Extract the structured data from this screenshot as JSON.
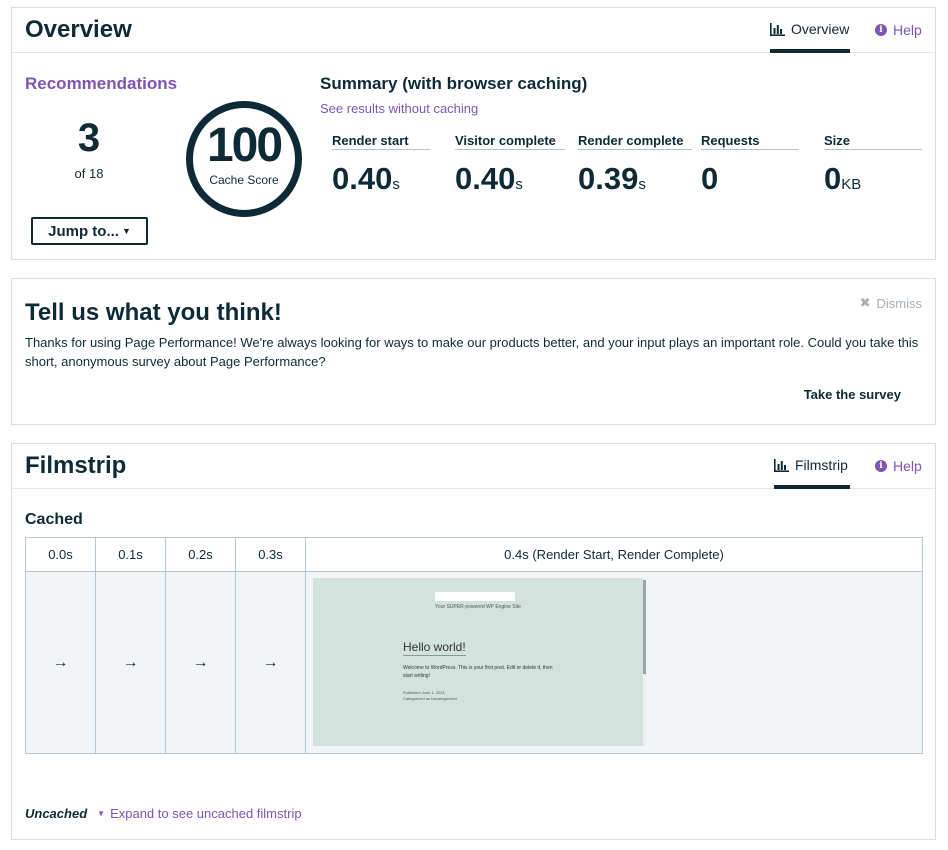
{
  "overview": {
    "title": "Overview",
    "tab_label": "Overview",
    "help_label": "Help",
    "recommendations": {
      "title": "Recommendations",
      "count": "3",
      "of_text": "of 18",
      "jump_label": "Jump to..."
    },
    "cache_score": {
      "value": "100",
      "label": "Cache Score"
    },
    "summary": {
      "title": "Summary (with browser caching)",
      "alt_link": "See results without caching",
      "metrics": [
        {
          "label": "Render start",
          "value": "0.40",
          "unit": "s"
        },
        {
          "label": "Visitor complete",
          "value": "0.40",
          "unit": "s"
        },
        {
          "label": "Render complete",
          "value": "0.39",
          "unit": "s"
        },
        {
          "label": "Requests",
          "value": "0",
          "unit": ""
        },
        {
          "label": "Size",
          "value": "0",
          "unit": "KB"
        }
      ]
    }
  },
  "feedback": {
    "title": "Tell us what you think!",
    "dismiss_label": "Dismiss",
    "body": "Thanks for using Page Performance! We're always looking for ways to make our products better, and your input plays an important role. Could you take this short, anonymous survey about Page Performance?",
    "survey_label": "Take the survey"
  },
  "filmstrip": {
    "title": "Filmstrip",
    "tab_label": "Filmstrip",
    "help_label": "Help",
    "cached_label": "Cached",
    "columns": [
      "0.0s",
      "0.1s",
      "0.2s",
      "0.3s",
      "0.4s (Render Start, Render Complete)"
    ],
    "arrow": "→",
    "frame": {
      "tagline": "Your SUPER-powered WP Engine Site",
      "heading": "Hello world!",
      "text": "Welcome to WordPress. This is your first post. Edit or delete it, then start writing!",
      "published": "Published June 1, 2021",
      "category": "Categorized as Uncategorized"
    },
    "uncached_label": "Uncached",
    "expand_label": "Expand to see uncached filmstrip"
  },
  "colors": {
    "accent": "#7f54b3",
    "navy": "#0e2a36",
    "frame_bg": "#d2e3dd"
  }
}
